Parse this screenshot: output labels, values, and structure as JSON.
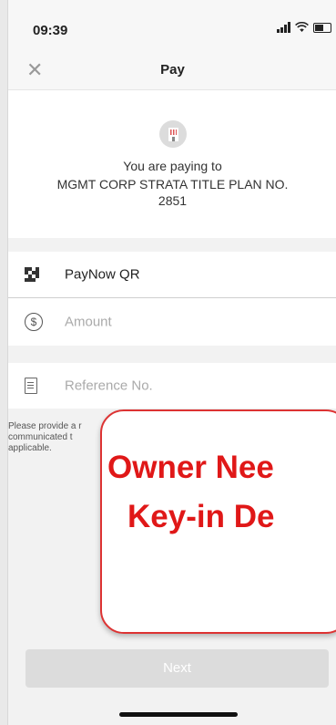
{
  "status_bar": {
    "time": "09:39",
    "icons": [
      "signal-icon",
      "wifi-icon",
      "battery-icon"
    ]
  },
  "navbar": {
    "title": "Pay",
    "close_icon": "close-icon"
  },
  "merchant": {
    "icon": "building-icon",
    "paying_label": "You are paying to",
    "name": "MGMT CORP STRATA   TITLE PLAN NO. 2851"
  },
  "payment_method": {
    "icon": "qr-code-icon",
    "label": "PayNow QR"
  },
  "amount_field": {
    "icon": "dollar-circle-icon",
    "placeholder": "Amount",
    "value": ""
  },
  "reference_field": {
    "icon": "receipt-icon",
    "placeholder": "Reference No.",
    "value": ""
  },
  "helper_text": "Please provide a r communicated t applicable.",
  "callout": {
    "line1": "Owner Nee",
    "line2": "Key-in De"
  },
  "next_button": {
    "label": "Next"
  },
  "colors": {
    "accent_red": "#e01818",
    "disabled_button": "#dcdcdc"
  }
}
